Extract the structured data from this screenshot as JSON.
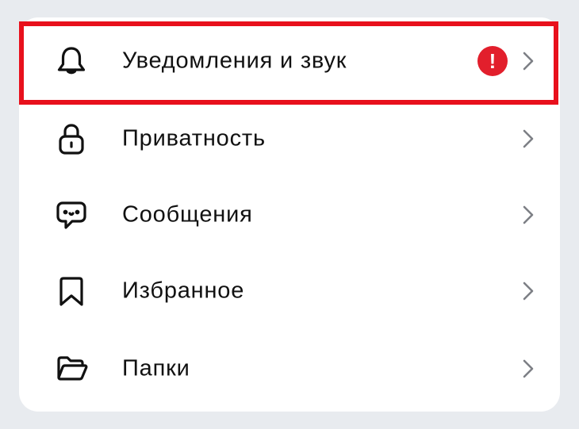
{
  "settings_menu": {
    "items": [
      {
        "label": "Уведомления и звук",
        "icon": "bell-icon",
        "badge": "!"
      },
      {
        "label": "Приватность",
        "icon": "lock-icon"
      },
      {
        "label": "Сообщения",
        "icon": "chat-bubble-icon"
      },
      {
        "label": "Избранное",
        "icon": "bookmark-icon"
      },
      {
        "label": "Папки",
        "icon": "folder-icon"
      }
    ]
  },
  "colors": {
    "background": "#e8ebef",
    "card": "#ffffff",
    "text": "#111111",
    "chevron": "#7d7f85",
    "badge": "#e21f2c",
    "highlight": "#e8101c"
  }
}
